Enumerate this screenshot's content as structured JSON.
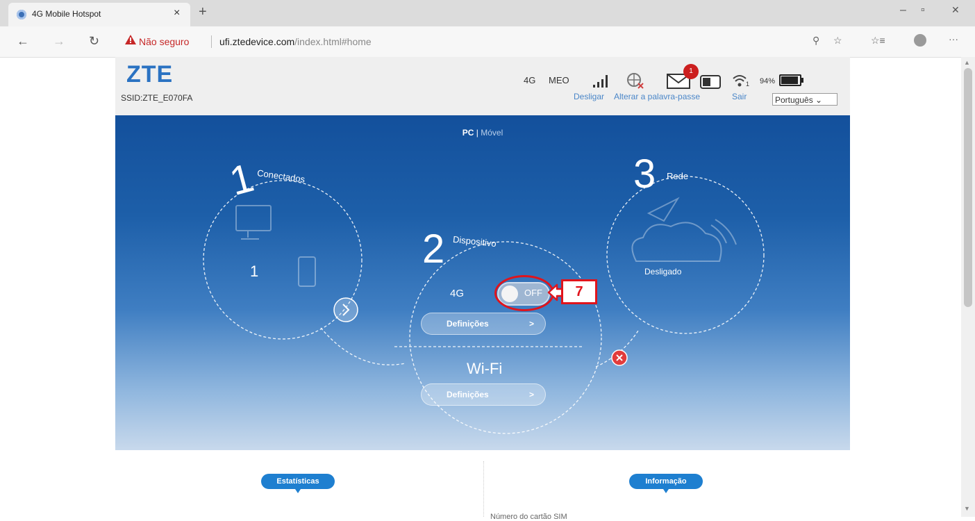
{
  "browser": {
    "tab_title": "4G Mobile Hotspot",
    "tab_close": "×",
    "new_tab": "+",
    "window_controls": {
      "minimize": "–",
      "maximize": "▫",
      "close": "✕"
    },
    "nav": {
      "back": "←",
      "forward": "→",
      "refresh": "↻"
    },
    "security_label": "Não seguro",
    "url_host": "ufi.ztedevice.com",
    "url_path": "/index.html#home",
    "toolbar": {
      "zoom": "⚲",
      "favorite": "☆",
      "favorites": "☆≡",
      "more": "···"
    },
    "icons": [
      "globe-icon",
      "warning-triangle-icon",
      "zoom-icon",
      "star-icon",
      "favorites-icon",
      "profile-icon",
      "more-icon"
    ]
  },
  "header": {
    "logo": "ZTE",
    "ssid": "SSID:ZTE_E070FA",
    "network_type": "4G",
    "operator": "MEO",
    "mail_count": "1",
    "wifi_clients": "1",
    "battery": "94%",
    "battery_level": 0.94,
    "links": {
      "disconnect": "Desligar",
      "change_password": "Alterar a palavra-passe",
      "logout": "Sair"
    },
    "language": "Português ⌄"
  },
  "hero": {
    "view_pc": "PC",
    "view_sep": " | ",
    "view_mobile": "Móvel",
    "connected": {
      "number": "1",
      "label": "Conectados",
      "device_count": "1"
    },
    "device": {
      "number": "2",
      "label": "Dispositivo",
      "mobile_label": "4G",
      "toggle_state": "OFF",
      "settings_4g": "Definições",
      "wifi_label": "Wi-Fi",
      "settings_wifi": "Definições",
      "chevron": ">"
    },
    "network": {
      "number": "3",
      "label": "Rede",
      "status": "Desligado"
    },
    "annotation_step": "7"
  },
  "bottom": {
    "statistics_badge": "Estatísticas",
    "info_badge": "Informação",
    "sim_label": "Número do cartão SIM"
  }
}
